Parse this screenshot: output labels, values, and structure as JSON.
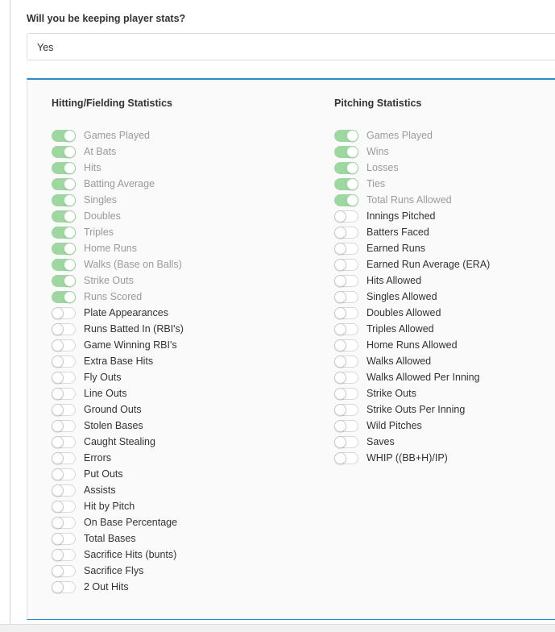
{
  "question": "Will you be keeping player stats?",
  "select": {
    "value": "Yes"
  },
  "hitting": {
    "title": "Hitting/Fielding Statistics",
    "items": [
      {
        "label": "Games Played",
        "on": true
      },
      {
        "label": "At Bats",
        "on": true
      },
      {
        "label": "Hits",
        "on": true
      },
      {
        "label": "Batting Average",
        "on": true
      },
      {
        "label": "Singles",
        "on": true
      },
      {
        "label": "Doubles",
        "on": true
      },
      {
        "label": "Triples",
        "on": true
      },
      {
        "label": "Home Runs",
        "on": true
      },
      {
        "label": "Walks (Base on Balls)",
        "on": true
      },
      {
        "label": "Strike Outs",
        "on": true
      },
      {
        "label": "Runs Scored",
        "on": true
      },
      {
        "label": "Plate Appearances",
        "on": false
      },
      {
        "label": "Runs Batted In (RBI's)",
        "on": false
      },
      {
        "label": "Game Winning RBI's",
        "on": false
      },
      {
        "label": "Extra Base Hits",
        "on": false
      },
      {
        "label": "Fly Outs",
        "on": false
      },
      {
        "label": "Line Outs",
        "on": false
      },
      {
        "label": "Ground Outs",
        "on": false
      },
      {
        "label": "Stolen Bases",
        "on": false
      },
      {
        "label": "Caught Stealing",
        "on": false
      },
      {
        "label": "Errors",
        "on": false
      },
      {
        "label": "Put Outs",
        "on": false
      },
      {
        "label": "Assists",
        "on": false
      },
      {
        "label": "Hit by Pitch",
        "on": false
      },
      {
        "label": "On Base Percentage",
        "on": false
      },
      {
        "label": "Total Bases",
        "on": false
      },
      {
        "label": "Sacrifice Hits (bunts)",
        "on": false
      },
      {
        "label": "Sacrifice Flys",
        "on": false
      },
      {
        "label": "2 Out Hits",
        "on": false
      }
    ]
  },
  "pitching": {
    "title": "Pitching Statistics",
    "items": [
      {
        "label": "Games Played",
        "on": true
      },
      {
        "label": "Wins",
        "on": true
      },
      {
        "label": "Losses",
        "on": true
      },
      {
        "label": "Ties",
        "on": true
      },
      {
        "label": "Total Runs Allowed",
        "on": true
      },
      {
        "label": "Innings Pitched",
        "on": false
      },
      {
        "label": "Batters Faced",
        "on": false
      },
      {
        "label": "Earned Runs",
        "on": false
      },
      {
        "label": "Earned Run Average (ERA)",
        "on": false
      },
      {
        "label": "Hits Allowed",
        "on": false
      },
      {
        "label": "Singles Allowed",
        "on": false
      },
      {
        "label": "Doubles Allowed",
        "on": false
      },
      {
        "label": "Triples Allowed",
        "on": false
      },
      {
        "label": "Home Runs Allowed",
        "on": false
      },
      {
        "label": "Walks Allowed",
        "on": false
      },
      {
        "label": "Walks Allowed Per Inning",
        "on": false
      },
      {
        "label": "Strike Outs",
        "on": false
      },
      {
        "label": "Strike Outs Per Inning",
        "on": false
      },
      {
        "label": "Wild Pitches",
        "on": false
      },
      {
        "label": "Saves",
        "on": false
      },
      {
        "label": "WHIP ((BB+H)/IP)",
        "on": false
      }
    ]
  },
  "colors": {
    "toggle_on": "#9ed7a1",
    "panel_accent": "#2e8bc9"
  }
}
